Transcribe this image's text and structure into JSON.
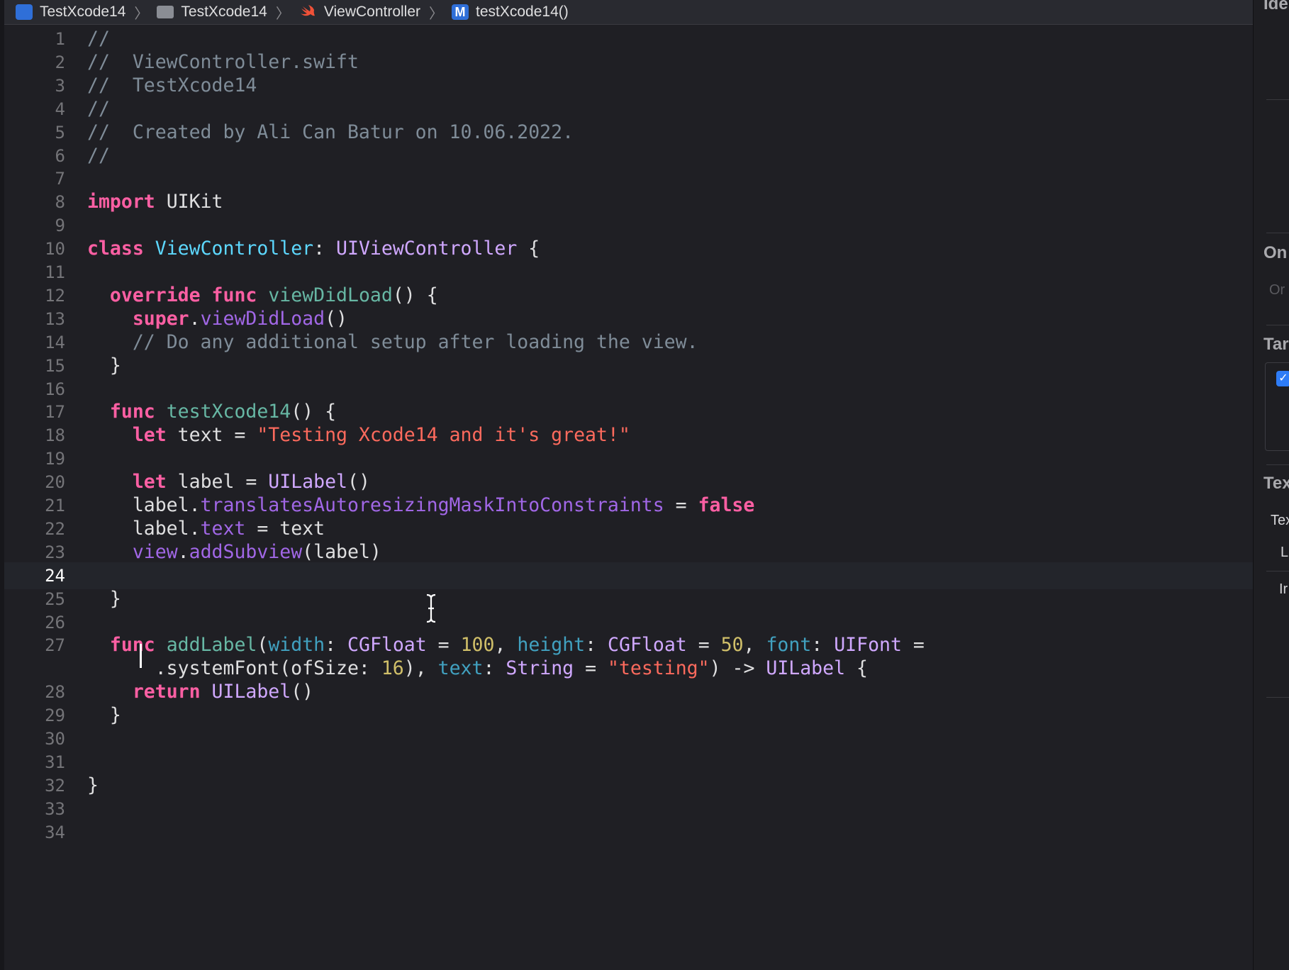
{
  "breadcrumb": [
    {
      "icon": "project-icon",
      "label": "TestXcode14"
    },
    {
      "icon": "folder-icon",
      "label": "TestXcode14"
    },
    {
      "icon": "swift-file-icon",
      "label": "ViewController"
    },
    {
      "icon": "method-icon",
      "badge": "M",
      "label": "testXcode14()"
    }
  ],
  "separator": "〉",
  "editor": {
    "current_line": 24,
    "lines": [
      {
        "n": "1",
        "tokens": [
          [
            "c",
            "//"
          ]
        ]
      },
      {
        "n": "2",
        "tokens": [
          [
            "c",
            "//  ViewController.swift"
          ]
        ]
      },
      {
        "n": "3",
        "tokens": [
          [
            "c",
            "//  TestXcode14"
          ]
        ]
      },
      {
        "n": "4",
        "tokens": [
          [
            "c",
            "//"
          ]
        ]
      },
      {
        "n": "5",
        "tokens": [
          [
            "c",
            "//  Created by Ali Can Batur on 10.06.2022."
          ]
        ]
      },
      {
        "n": "6",
        "tokens": [
          [
            "c",
            "//"
          ]
        ]
      },
      {
        "n": "7",
        "tokens": []
      },
      {
        "n": "8",
        "tokens": [
          [
            "k",
            "import"
          ],
          [
            "p",
            " UIKit"
          ]
        ]
      },
      {
        "n": "9",
        "tokens": []
      },
      {
        "n": "10",
        "tokens": [
          [
            "k",
            "class"
          ],
          [
            "p",
            " "
          ],
          [
            "t",
            "ViewController"
          ],
          [
            "p",
            ": "
          ],
          [
            "pt",
            "UIViewController"
          ],
          [
            "p",
            " {"
          ]
        ]
      },
      {
        "n": "11",
        "tokens": []
      },
      {
        "n": "12",
        "tokens": [
          [
            "p",
            "  "
          ],
          [
            "k",
            "override"
          ],
          [
            "p",
            " "
          ],
          [
            "k",
            "func"
          ],
          [
            "p",
            " "
          ],
          [
            "f",
            "viewDidLoad"
          ],
          [
            "p",
            "() {"
          ]
        ]
      },
      {
        "n": "13",
        "tokens": [
          [
            "p",
            "    "
          ],
          [
            "k",
            "super"
          ],
          [
            "p",
            "."
          ],
          [
            "pf",
            "viewDidLoad"
          ],
          [
            "p",
            "()"
          ]
        ]
      },
      {
        "n": "14",
        "tokens": [
          [
            "p",
            "    "
          ],
          [
            "c",
            "// Do any additional setup after loading the view."
          ]
        ]
      },
      {
        "n": "15",
        "tokens": [
          [
            "p",
            "  }"
          ]
        ]
      },
      {
        "n": "16",
        "tokens": []
      },
      {
        "n": "17",
        "tokens": [
          [
            "p",
            "  "
          ],
          [
            "k",
            "func"
          ],
          [
            "p",
            " "
          ],
          [
            "f",
            "testXcode14"
          ],
          [
            "p",
            "() {"
          ]
        ]
      },
      {
        "n": "18",
        "tokens": [
          [
            "p",
            "    "
          ],
          [
            "k",
            "let"
          ],
          [
            "p",
            " text = "
          ],
          [
            "s",
            "\"Testing Xcode14 and it's great!\""
          ]
        ]
      },
      {
        "n": "19",
        "tokens": []
      },
      {
        "n": "20",
        "tokens": [
          [
            "p",
            "    "
          ],
          [
            "k",
            "let"
          ],
          [
            "p",
            " label = "
          ],
          [
            "pt",
            "UILabel"
          ],
          [
            "p",
            "()"
          ]
        ]
      },
      {
        "n": "21",
        "tokens": [
          [
            "p",
            "    label."
          ],
          [
            "pf",
            "translatesAutoresizingMaskIntoConstraints"
          ],
          [
            "p",
            " = "
          ],
          [
            "k",
            "false"
          ]
        ]
      },
      {
        "n": "22",
        "tokens": [
          [
            "p",
            "    label."
          ],
          [
            "pf",
            "text"
          ],
          [
            "p",
            " = text"
          ]
        ]
      },
      {
        "n": "23",
        "tokens": [
          [
            "p",
            "    "
          ],
          [
            "pf",
            "view"
          ],
          [
            "p",
            "."
          ],
          [
            "pf",
            "addSubview"
          ],
          [
            "p",
            "(label)"
          ]
        ]
      },
      {
        "n": "24",
        "tokens": []
      },
      {
        "n": "25",
        "tokens": [
          [
            "p",
            "  }"
          ]
        ]
      },
      {
        "n": "26",
        "tokens": []
      },
      {
        "n": "27",
        "tokens": [
          [
            "p",
            "  "
          ],
          [
            "k",
            "func"
          ],
          [
            "p",
            " "
          ],
          [
            "f",
            "addLabel"
          ],
          [
            "p",
            "("
          ],
          [
            "pa",
            "width"
          ],
          [
            "p",
            ": "
          ],
          [
            "pt",
            "CGFloat"
          ],
          [
            "p",
            " = "
          ],
          [
            "nu",
            "100"
          ],
          [
            "p",
            ", "
          ],
          [
            "pa",
            "height"
          ],
          [
            "p",
            ": "
          ],
          [
            "pt",
            "CGFloat"
          ],
          [
            "p",
            " = "
          ],
          [
            "nu",
            "50"
          ],
          [
            "p",
            ", "
          ],
          [
            "pa",
            "font"
          ],
          [
            "p",
            ": "
          ],
          [
            "pt",
            "UIFont"
          ],
          [
            "p",
            " ="
          ]
        ]
      },
      {
        "n": "",
        "tokens": [
          [
            "p",
            "      .systemFont(ofSize: "
          ],
          [
            "nu",
            "16"
          ],
          [
            "p",
            "), "
          ],
          [
            "pa",
            "text"
          ],
          [
            "p",
            ": "
          ],
          [
            "pt",
            "String"
          ],
          [
            "p",
            " = "
          ],
          [
            "s",
            "\"testing\""
          ],
          [
            "p",
            ") -> "
          ],
          [
            "pt",
            "UILabel"
          ],
          [
            "p",
            " {"
          ]
        ]
      },
      {
        "n": "28",
        "tokens": [
          [
            "p",
            "    "
          ],
          [
            "k",
            "return"
          ],
          [
            "p",
            " "
          ],
          [
            "pt",
            "UILabel"
          ],
          [
            "p",
            "()"
          ]
        ]
      },
      {
        "n": "29",
        "tokens": [
          [
            "p",
            "  }"
          ]
        ]
      },
      {
        "n": "30",
        "tokens": []
      },
      {
        "n": "31",
        "tokens": []
      },
      {
        "n": "32",
        "tokens": [
          [
            "p",
            "}"
          ]
        ]
      },
      {
        "n": "33",
        "tokens": []
      },
      {
        "n": "34",
        "tokens": []
      }
    ]
  },
  "inspector": {
    "top_label": "Ide",
    "on_demand_header": "On",
    "on_demand_placeholder": "Or",
    "target_header": "Tar",
    "text_header": "Tex",
    "text_row1": "Tex",
    "text_row2": "L",
    "text_row3": "Ir"
  }
}
